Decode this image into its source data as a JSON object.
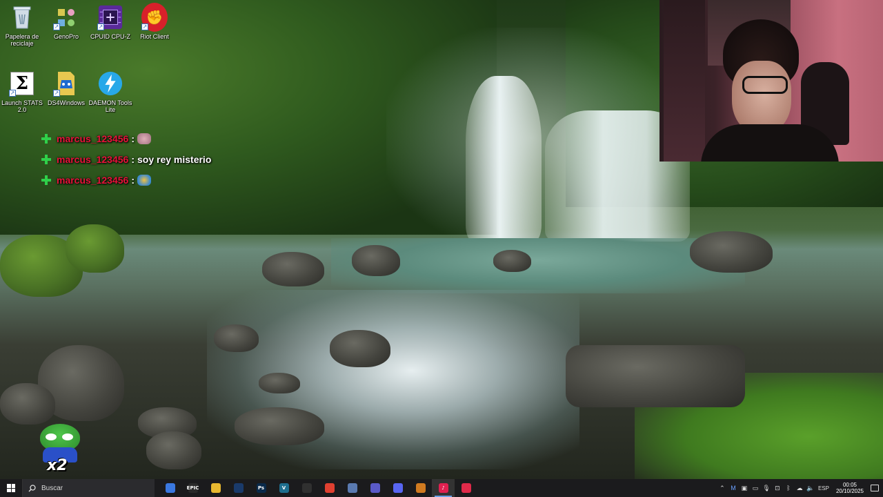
{
  "desktop": {
    "icons": [
      {
        "label": "Papelera de reciclaje",
        "icon": "recycle-bin-icon"
      },
      {
        "label": "GenoPro",
        "icon": "genopro-icon"
      },
      {
        "label": "CPUID CPU-Z",
        "icon": "cpuz-icon"
      },
      {
        "label": "Riot Client",
        "icon": "riot-client-icon"
      },
      {
        "label": "Launch STATS 2.0",
        "icon": "stats-sigma-icon"
      },
      {
        "label": "DS4Windows",
        "icon": "ds4windows-icon"
      },
      {
        "label": "DAEMON Tools Lite",
        "icon": "daemon-tools-icon"
      }
    ],
    "icon_glyphs": {
      "stats": "Σ",
      "riot": "✊"
    }
  },
  "chat": {
    "messages": [
      {
        "user": "marcus_123456",
        "separator": ":",
        "text": ""
      },
      {
        "user": "marcus_123456",
        "separator": ":",
        "text": "soy rey misterio"
      },
      {
        "user": "marcus_123456",
        "separator": ":",
        "text": ""
      }
    ],
    "user_color": "#e8123a",
    "badge_color": "#2fd04a"
  },
  "overlay": {
    "sticker_text": "x2"
  },
  "taskbar": {
    "search_placeholder": "Buscar",
    "apps": [
      {
        "name": "copilot-icon",
        "label": "",
        "color": "#3a78e0",
        "active": false
      },
      {
        "name": "epic-games-icon",
        "label": "EPIC",
        "color": "#2a2a2a",
        "active": false
      },
      {
        "name": "file-explorer-icon",
        "label": "",
        "color": "#e8b830",
        "active": false
      },
      {
        "name": "steam-icon",
        "label": "",
        "color": "#1a3a6a",
        "active": false
      },
      {
        "name": "photoshop-icon",
        "label": "Ps",
        "color": "#0a2a4a",
        "active": false
      },
      {
        "name": "visual-studio-icon",
        "label": "V",
        "color": "#1e6e8e",
        "active": false
      },
      {
        "name": "obs-icon",
        "label": "",
        "color": "#303030",
        "active": false
      },
      {
        "name": "chrome-icon",
        "label": "",
        "color": "#e04030",
        "active": false
      },
      {
        "name": "app-diamond-icon",
        "label": "",
        "color": "#5a7ab0",
        "active": false
      },
      {
        "name": "teams-icon",
        "label": "",
        "color": "#5a5ac8",
        "active": false
      },
      {
        "name": "discord-icon",
        "label": "",
        "color": "#5865f2",
        "active": false
      },
      {
        "name": "app-shield-icon",
        "label": "",
        "color": "#d07a20",
        "active": false
      },
      {
        "name": "tiktok-icon",
        "label": "♪",
        "color": "#e02050",
        "active": true
      },
      {
        "name": "app-red-icon",
        "label": "",
        "color": "#e02a4a",
        "active": false
      }
    ],
    "tray": {
      "language": "ESP",
      "time": "00:05",
      "date": "20/10/2025"
    }
  }
}
